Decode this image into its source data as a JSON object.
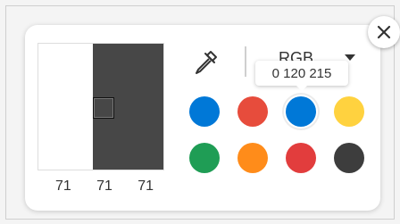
{
  "preview": {
    "original_color": "#ffffff",
    "current_color": "#474747",
    "rgb": [
      "71",
      "71",
      "71"
    ]
  },
  "toolbar": {
    "eyedropper_icon": "eyedropper-icon",
    "mode_label": "RGB",
    "mode_caret_icon": "chevron-down-icon"
  },
  "tooltip": {
    "text": "0 120 215"
  },
  "close": {
    "icon": "close-icon"
  },
  "swatches": [
    {
      "color": "#0078d7",
      "selected": false
    },
    {
      "color": "#e74c3c",
      "selected": false
    },
    {
      "color": "#0078d7",
      "selected": true
    },
    {
      "color": "#ffd23f",
      "selected": false
    },
    {
      "color": "#1f9d55",
      "selected": false
    },
    {
      "color": "#ff8c1a",
      "selected": false
    },
    {
      "color": "#e23d3d",
      "selected": false
    },
    {
      "color": "#3d3d3d",
      "selected": false
    }
  ]
}
